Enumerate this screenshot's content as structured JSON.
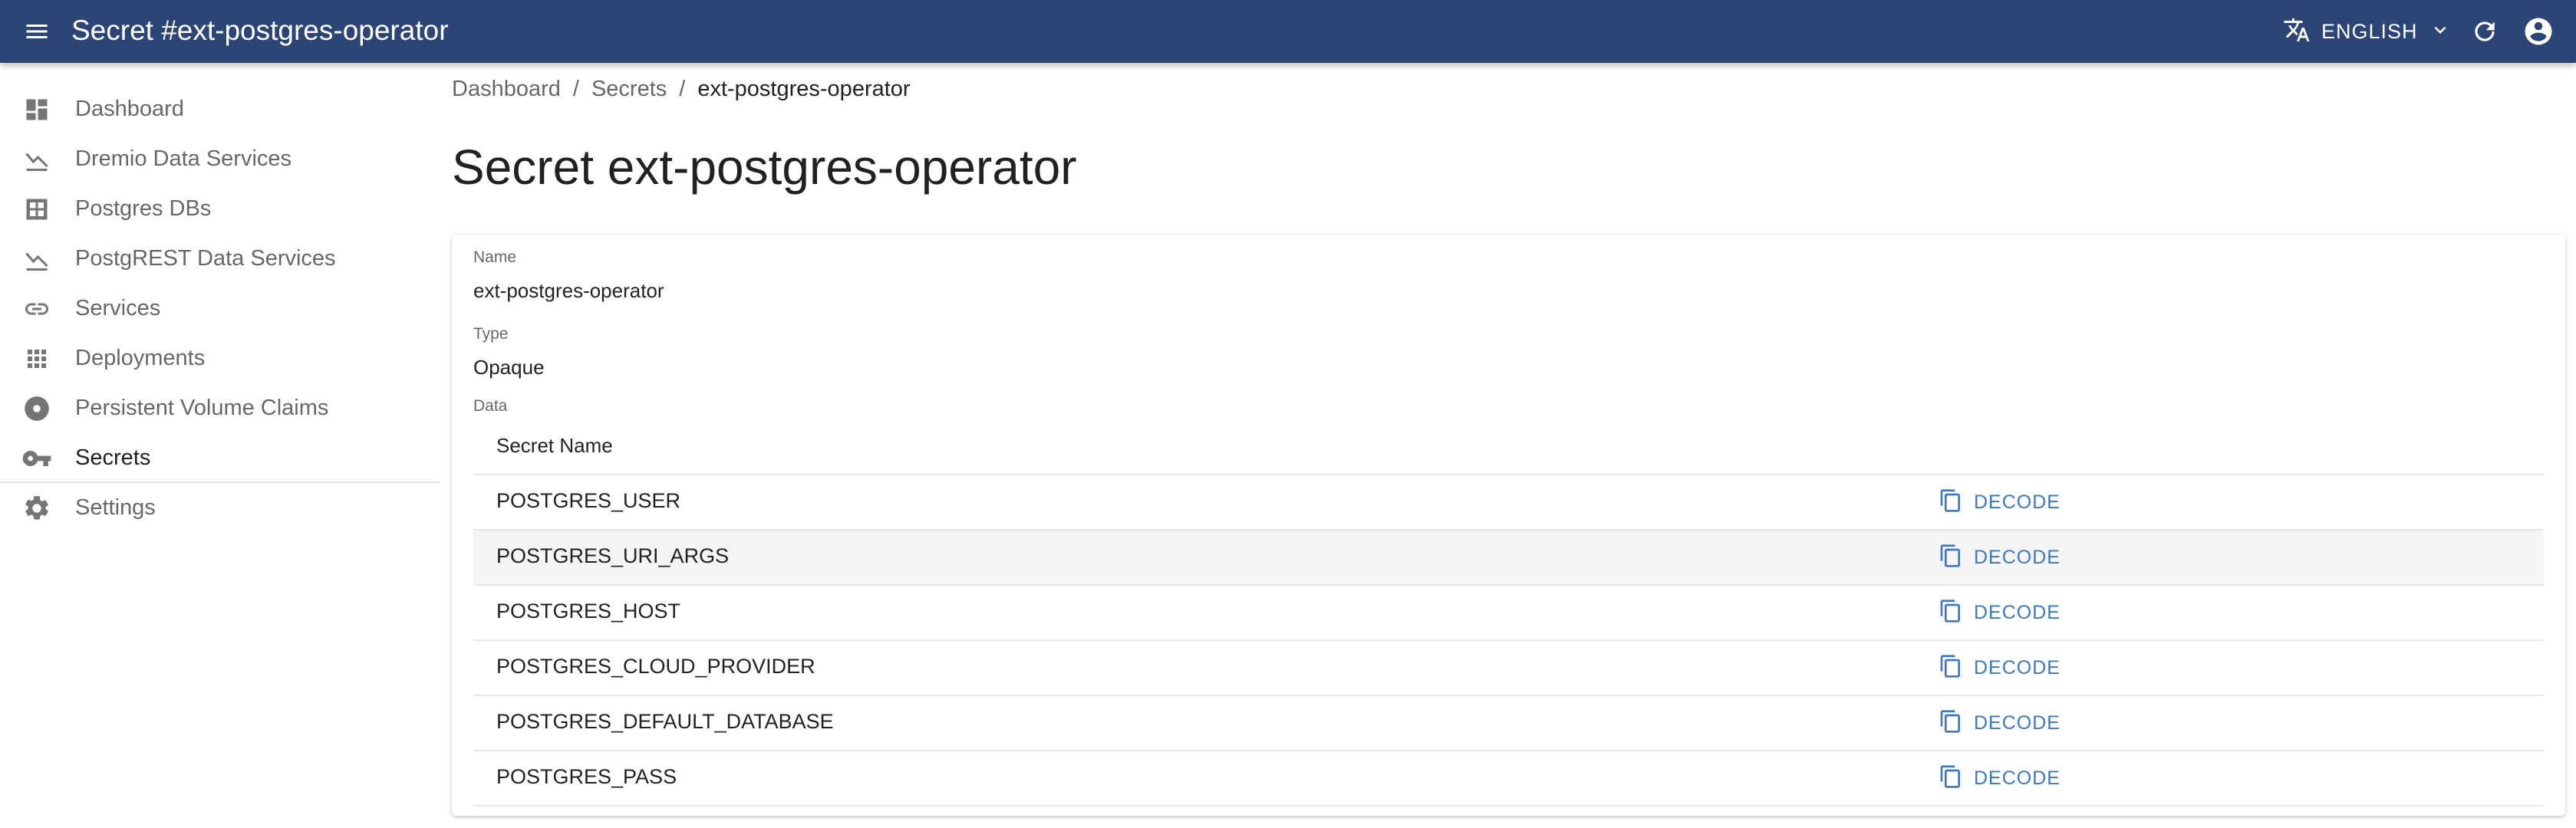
{
  "appbar": {
    "title": "Secret #ext-postgres-operator",
    "language": "ENGLISH",
    "icons": {
      "menu": "menu-icon",
      "translate": "translate-icon",
      "chevron": "chevron-down-icon",
      "refresh": "refresh-icon",
      "account": "account-circle-icon"
    },
    "background": "#2c4574"
  },
  "sidebar": {
    "items": [
      {
        "label": "Dashboard",
        "icon": "dashboard-icon"
      },
      {
        "label": "Dremio Data Services",
        "icon": "chart-line-down-icon"
      },
      {
        "label": "Postgres DBs",
        "icon": "grid-box-icon"
      },
      {
        "label": "PostgREST Data Services",
        "icon": "chart-line-down-icon"
      },
      {
        "label": "Services",
        "icon": "link-icon"
      },
      {
        "label": "Deployments",
        "icon": "apps-grid-icon"
      },
      {
        "label": "Persistent Volume Claims",
        "icon": "disc-icon"
      },
      {
        "label": "Secrets",
        "icon": "key-icon"
      },
      {
        "label": "Settings",
        "icon": "gear-icon"
      }
    ]
  },
  "breadcrumb": {
    "items": [
      "Dashboard",
      "Secrets",
      "ext-postgres-operator"
    ],
    "separator": "/"
  },
  "page": {
    "title": "Secret ext-postgres-operator"
  },
  "details": {
    "name_label": "Name",
    "name_value": "ext-postgres-operator",
    "type_label": "Type",
    "type_value": "Opaque",
    "data_label": "Data"
  },
  "table": {
    "header": "Secret Name",
    "action_label": "DECODE",
    "accent": "#3d79c3",
    "rows": [
      "POSTGRES_USER",
      "POSTGRES_URI_ARGS",
      "POSTGRES_HOST",
      "POSTGRES_CLOUD_PROVIDER",
      "POSTGRES_DEFAULT_DATABASE",
      "POSTGRES_PASS"
    ]
  }
}
